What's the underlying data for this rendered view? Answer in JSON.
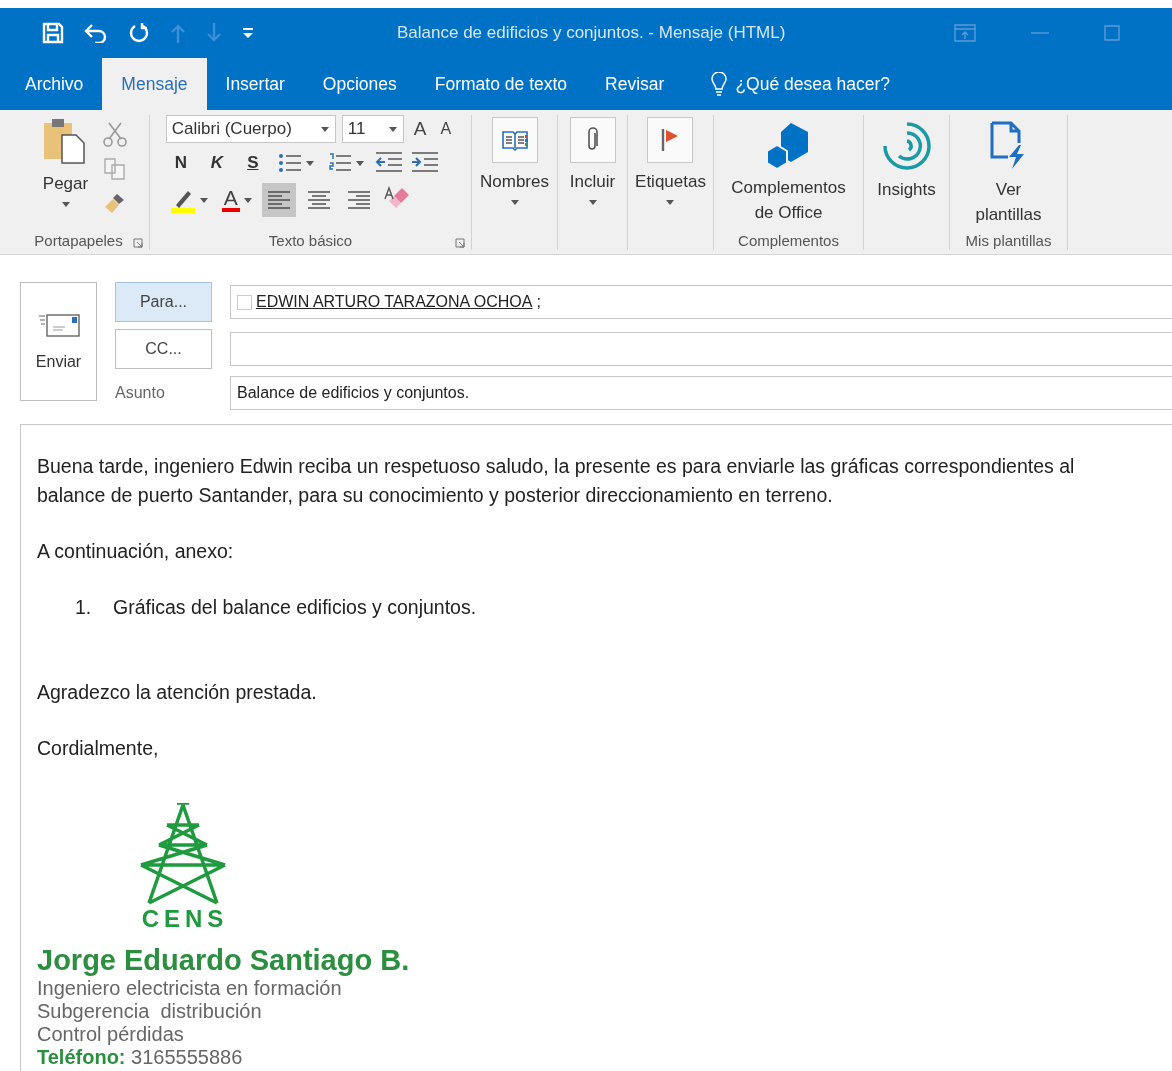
{
  "window": {
    "title": "Balance de edificios y conjuntos. - Mensaje (HTML)"
  },
  "quick_access": [
    {
      "kind": "save",
      "disabled": false
    },
    {
      "kind": "undo",
      "disabled": false
    },
    {
      "kind": "redo",
      "disabled": false
    },
    {
      "kind": "up",
      "disabled": true
    },
    {
      "kind": "down",
      "disabled": true
    },
    {
      "kind": "customize",
      "disabled": false
    }
  ],
  "tabs": [
    {
      "label": "Archivo",
      "selected": false
    },
    {
      "label": "Mensaje",
      "selected": true
    },
    {
      "label": "Insertar",
      "selected": false
    },
    {
      "label": "Opciones",
      "selected": false
    },
    {
      "label": "Formato de texto",
      "selected": false
    },
    {
      "label": "Revisar",
      "selected": false
    }
  ],
  "tell_me": {
    "placeholder": "¿Qué desea hacer?"
  },
  "ribbon": {
    "groups": [
      {
        "kind": "clipboard",
        "label": "Portapapeles",
        "launcher": true,
        "paste": {
          "label": "Pegar",
          "dropdown": true
        }
      },
      {
        "kind": "text",
        "label": "Texto básico",
        "launcher": true,
        "font": "Calibri (Cuerpo)",
        "size": "11",
        "grow": "A",
        "shrink": "A",
        "bold": "N",
        "italic": "K",
        "underline": "S",
        "font_color": "A",
        "alignment": [
          {
            "selected": true
          },
          {
            "selected": false
          },
          {
            "selected": false
          }
        ]
      },
      {
        "kind": "buttons",
        "buttons": [
          {
            "kind": "address-book",
            "label_lines": [
              "Nombres"
            ],
            "dropdown": true
          }
        ]
      },
      {
        "kind": "buttons",
        "buttons": [
          {
            "kind": "attach",
            "label_lines": [
              "Incluir"
            ],
            "dropdown": true
          }
        ]
      },
      {
        "kind": "buttons",
        "buttons": [
          {
            "kind": "flag",
            "label_lines": [
              "Etiquetas"
            ],
            "dropdown": true
          }
        ]
      },
      {
        "kind": "buttons",
        "label": "Complementos",
        "buttons": [
          {
            "kind": "addins",
            "label_lines": [
              "Complementos",
              "de Office"
            ],
            "dropdown": false
          }
        ]
      },
      {
        "kind": "buttons",
        "buttons": [
          {
            "kind": "insights",
            "label_lines": [
              "Insights"
            ],
            "dropdown": false
          }
        ]
      },
      {
        "kind": "buttons",
        "label": "Mis plantillas",
        "buttons": [
          {
            "kind": "templates",
            "label_lines": [
              "Ver",
              "plantillas"
            ],
            "dropdown": false
          }
        ]
      }
    ]
  },
  "compose": {
    "send": {
      "label": "Enviar"
    },
    "to": {
      "button": "Para...",
      "selected": true,
      "recipient": "EDWIN ARTURO TARAZONA OCHOA",
      "separator": ";"
    },
    "cc": {
      "button": "CC...",
      "selected": false
    },
    "subject": {
      "label": "Asunto",
      "value": "Balance de edificios y conjuntos."
    }
  },
  "body": [
    {
      "kind": "paragraph",
      "text": "Buena tarde, ingeniero Edwin reciba un respetuoso saludo, la presente es para enviarle las gráficas correspondientes al balance de puerto Santander, para su conocimiento y posterior direccionamiento en terreno."
    },
    {
      "kind": "paragraph",
      "text": "A continuación, anexo:"
    },
    {
      "kind": "list",
      "items": [
        {
          "number": "1.",
          "text": "Gráficas del balance edificios y conjuntos."
        }
      ]
    },
    {
      "kind": "paragraph",
      "text": "Agradezco la atención prestada."
    },
    {
      "kind": "paragraph",
      "text": "Cordialmente,"
    }
  ],
  "signature": {
    "logo_text": "CENS",
    "name": "Jorge Eduardo Santiago B.",
    "lines": [
      "Ingeniero electricista en formación",
      "Subgerencia  distribución",
      "Control pérdidas"
    ],
    "phone": "**Teléfono:** 3165555886"
  }
}
